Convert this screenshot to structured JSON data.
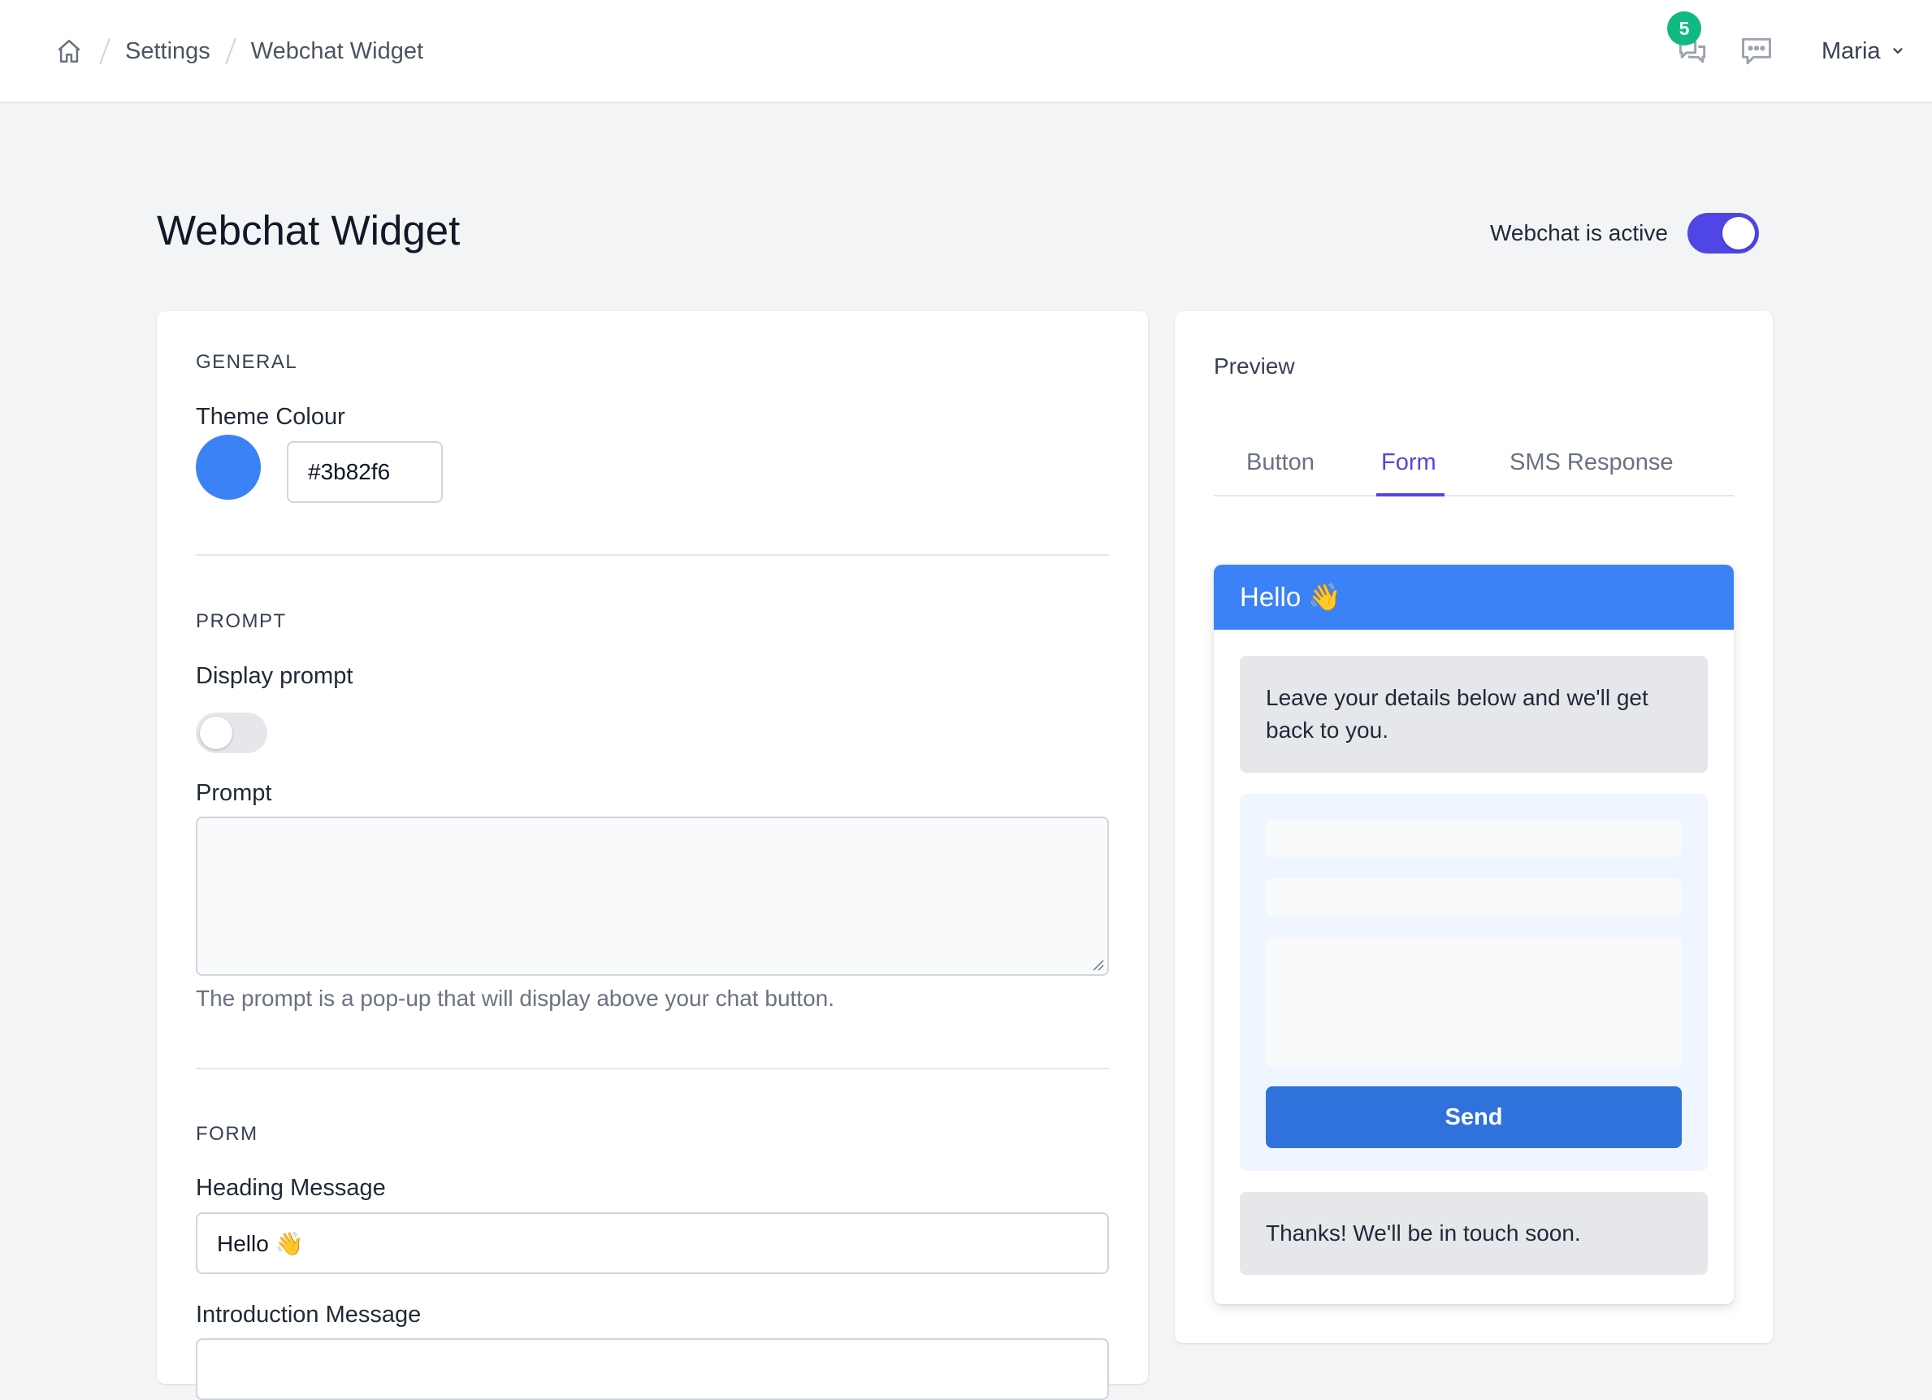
{
  "breadcrumb": {
    "home_icon": "home-icon",
    "items": [
      "Settings",
      "Webchat Widget"
    ]
  },
  "header": {
    "notification_count": "5",
    "inbox_icon": "chat-bubbles-icon",
    "messages_icon": "chat-bubble-dots-icon",
    "user_name": "Maria"
  },
  "page": {
    "title": "Webchat Widget",
    "active_label": "Webchat is active",
    "active": true
  },
  "settings": {
    "general": {
      "heading": "GENERAL",
      "theme_colour_label": "Theme Colour",
      "theme_colour": "#3b82f6"
    },
    "prompt": {
      "heading": "PROMPT",
      "display_prompt_label": "Display prompt",
      "display_prompt": false,
      "prompt_label": "Prompt",
      "prompt_value": "",
      "help_text": "The prompt is a pop-up that will display above your chat button."
    },
    "form": {
      "heading": "FORM",
      "heading_message_label": "Heading Message",
      "heading_message": "Hello 👋",
      "introduction_message_label": "Introduction Message"
    }
  },
  "preview": {
    "title": "Preview",
    "tabs": [
      "Button",
      "Form",
      "SMS Response"
    ],
    "active_tab": "Form",
    "widget": {
      "header_text": "Hello 👋",
      "intro_text": "Leave your details below and we'll get back to you.",
      "send_label": "Send",
      "thanks_text": "Thanks! We'll be in touch soon."
    }
  },
  "colors": {
    "accent": "#4f46e5",
    "theme": "#3b82f6",
    "send_button": "#3072dc",
    "badge": "#10b981"
  }
}
